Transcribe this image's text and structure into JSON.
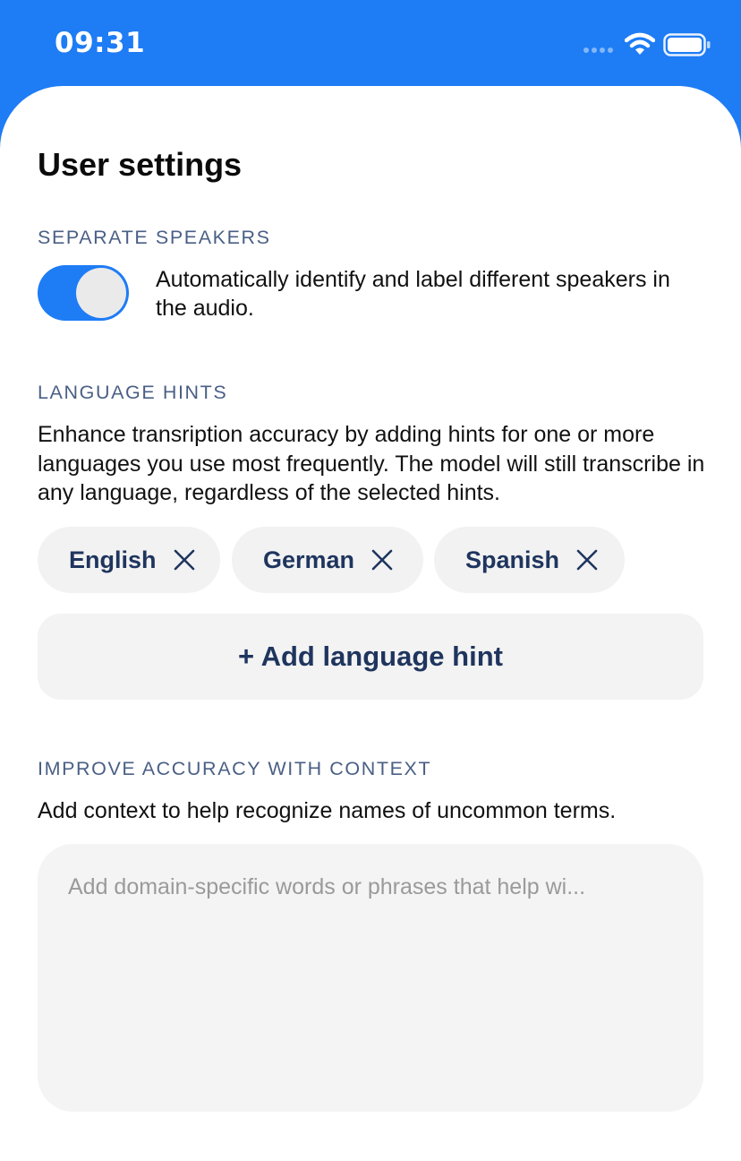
{
  "status_bar": {
    "time": "09:31",
    "icons": [
      "signal-icon",
      "wifi-icon",
      "battery-icon"
    ]
  },
  "page": {
    "title": "User settings"
  },
  "separate_speakers": {
    "section_label": "SEPARATE SPEAKERS",
    "toggle_on": true,
    "description": "Automatically identify and label different speakers in the audio."
  },
  "language_hints": {
    "section_label": "LANGUAGE HINTS",
    "description": "Enhance transription accuracy by adding hints for one or more languages you use most frequently. The model will still transcribe in any language, regardless of the selected hints.",
    "chips": [
      {
        "label": "English",
        "remove_icon": "close-icon"
      },
      {
        "label": "German",
        "remove_icon": "close-icon"
      },
      {
        "label": "Spanish",
        "remove_icon": "close-icon"
      }
    ],
    "add_button_label": "+ Add language hint"
  },
  "context": {
    "section_label": "IMPROVE ACCURACY WITH CONTEXT",
    "description": "Add context to help recognize names of uncommon terms.",
    "input_value": "",
    "input_placeholder": "Add domain-specific words or phrases that help wi..."
  },
  "colors": {
    "accent": "#1E7CF5",
    "section_label": "#4a5f85",
    "chip_text": "#1f355e",
    "chip_bg": "#f2f2f2"
  }
}
